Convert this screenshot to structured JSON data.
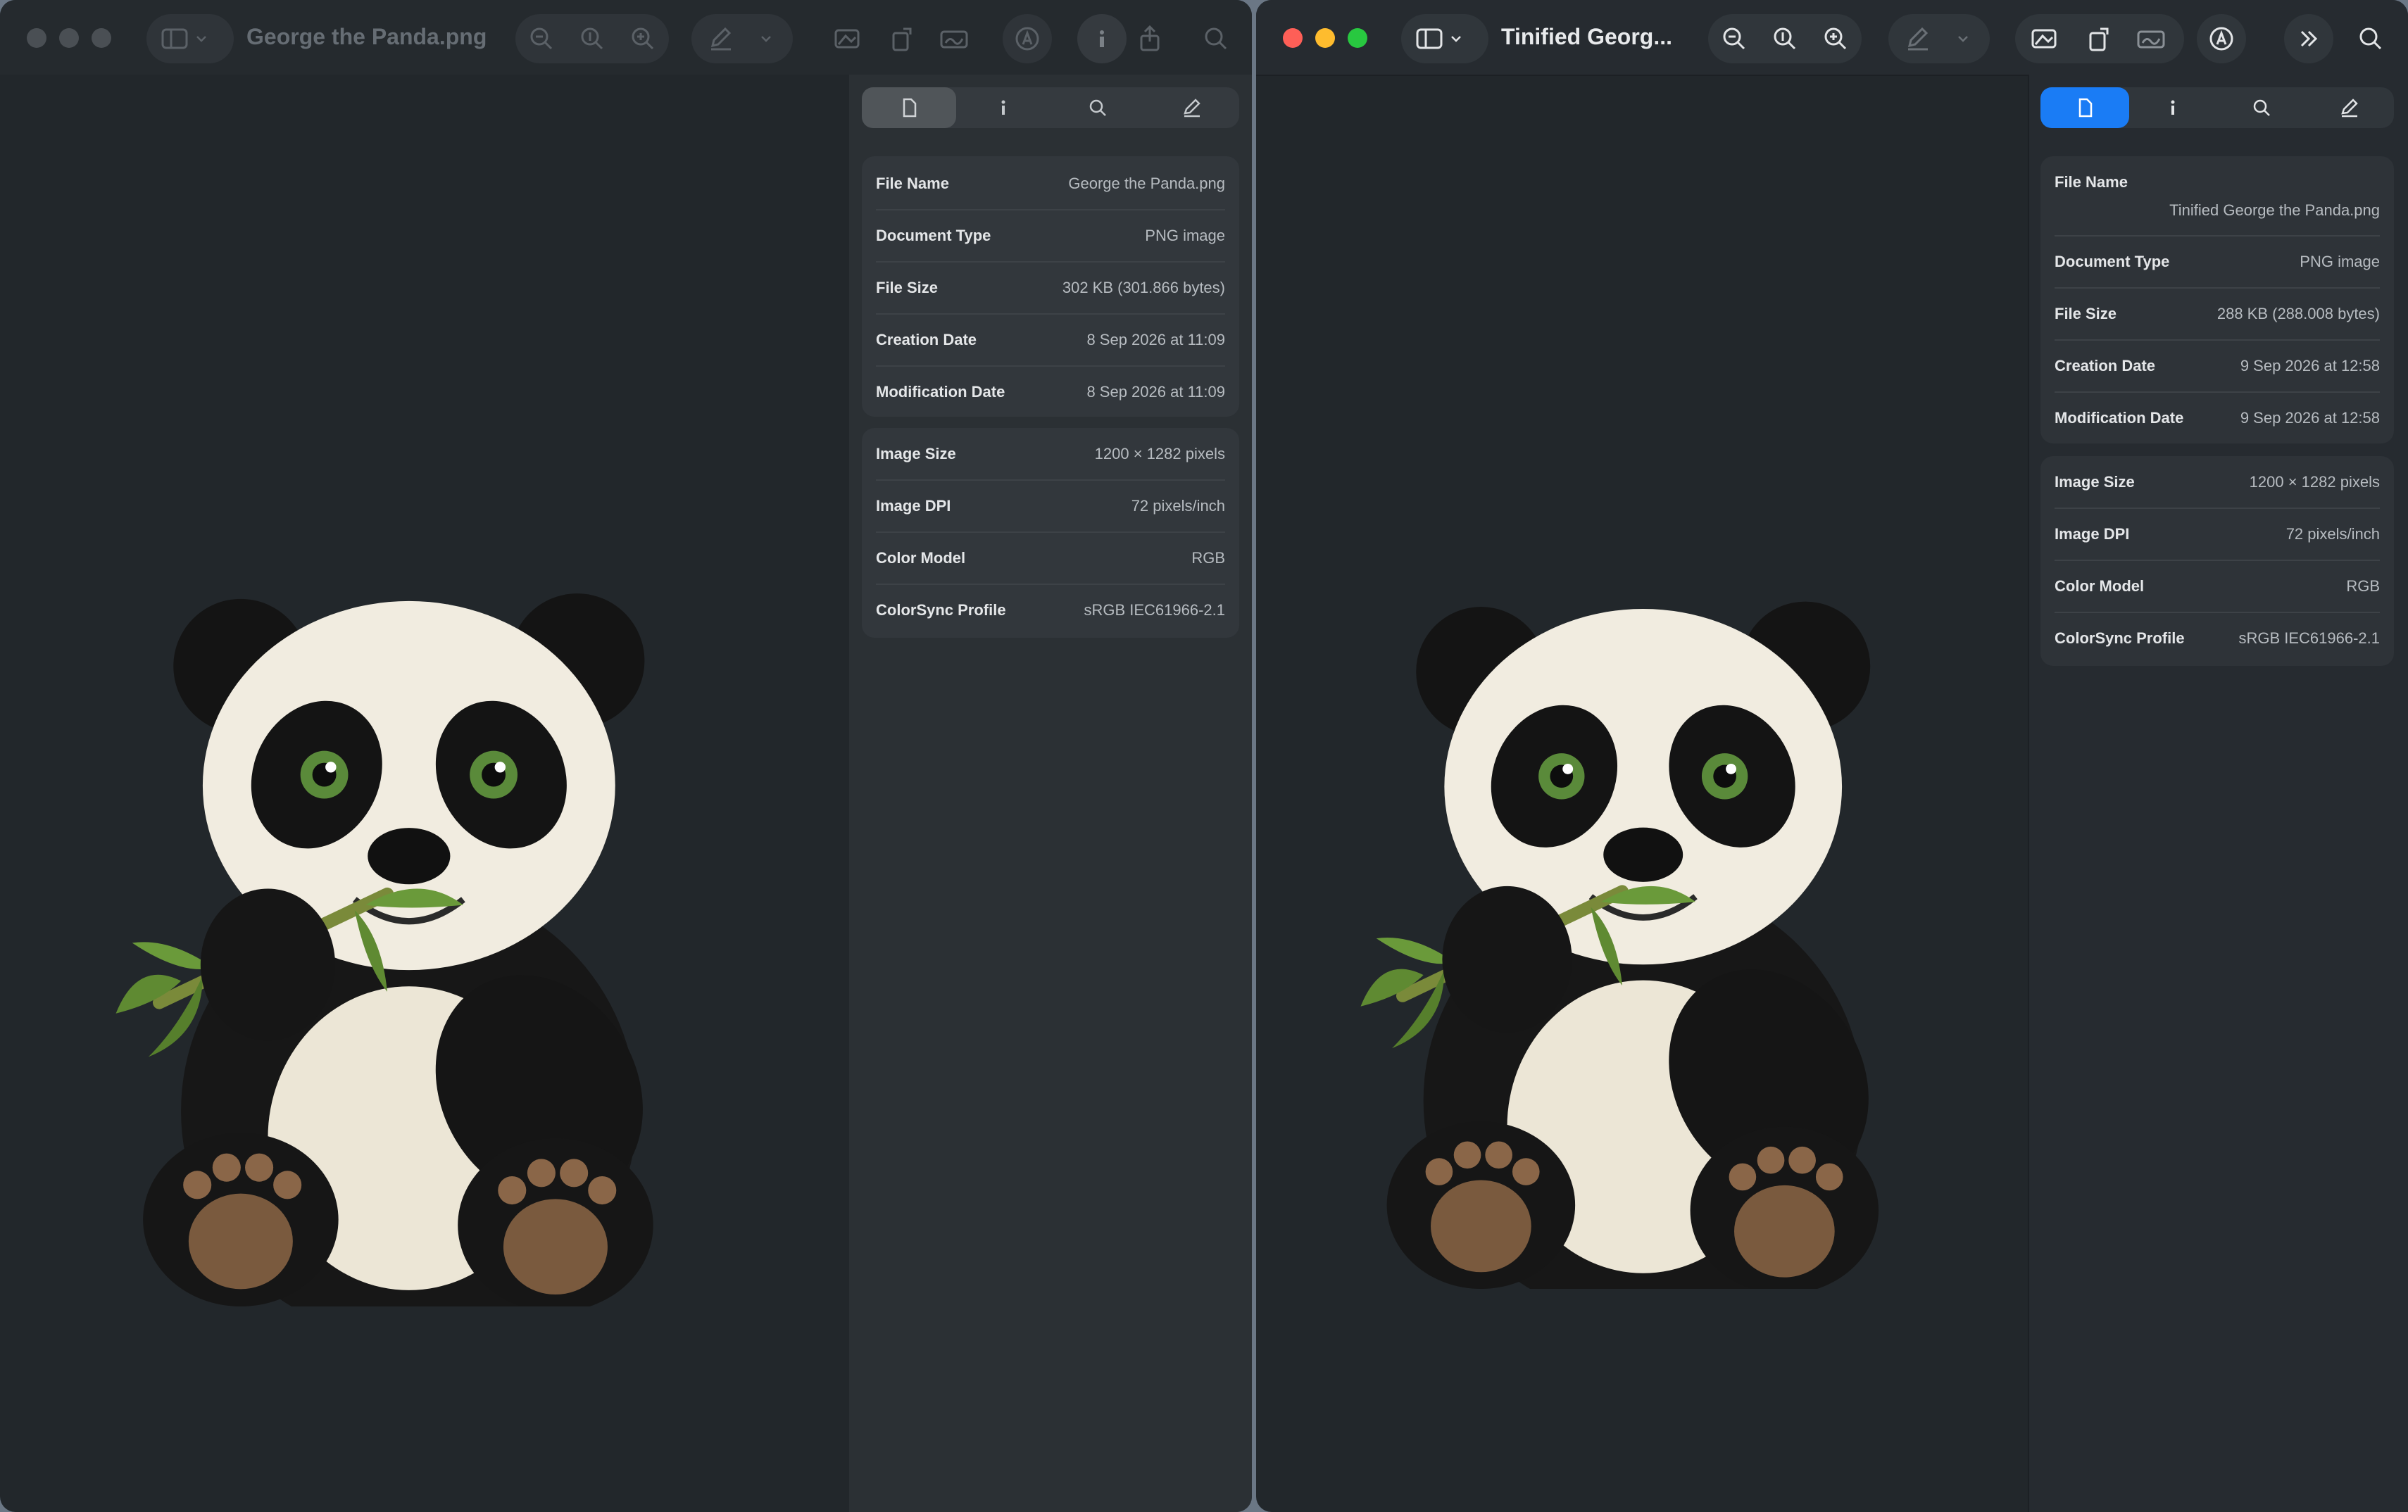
{
  "left_window": {
    "title": "George the Panda.png",
    "info": {
      "file": [
        {
          "label": "File Name",
          "value": "George the Panda.png"
        },
        {
          "label": "Document Type",
          "value": "PNG image"
        },
        {
          "label": "File Size",
          "value": "302 KB (301.866 bytes)"
        },
        {
          "label": "Creation Date",
          "value": "8 Sep 2026 at 11:09"
        },
        {
          "label": "Modification Date",
          "value": "8 Sep 2026 at 11:09"
        }
      ],
      "image": [
        {
          "label": "Image Size",
          "value": "1200 × 1282 pixels"
        },
        {
          "label": "Image DPI",
          "value": "72 pixels/inch"
        },
        {
          "label": "Color Model",
          "value": "RGB"
        },
        {
          "label": "ColorSync Profile",
          "value": "sRGB IEC61966-2.1"
        }
      ]
    }
  },
  "right_window": {
    "title": "Tinified Georg...",
    "info": {
      "file": [
        {
          "label": "File Name",
          "value": "Tinified George the Panda.png"
        },
        {
          "label": "Document Type",
          "value": "PNG image"
        },
        {
          "label": "File Size",
          "value": "288 KB (288.008 bytes)"
        },
        {
          "label": "Creation Date",
          "value": "9 Sep 2026 at 12:58"
        },
        {
          "label": "Modification Date",
          "value": "9 Sep 2026 at 12:58"
        }
      ],
      "image": [
        {
          "label": "Image Size",
          "value": "1200 × 1282 pixels"
        },
        {
          "label": "Image DPI",
          "value": "72 pixels/inch"
        },
        {
          "label": "Color Model",
          "value": "RGB"
        },
        {
          "label": "ColorSync Profile",
          "value": "sRGB IEC61966-2.1"
        }
      ]
    }
  },
  "colors": {
    "accent": "#1a7cf5",
    "close": "#fe5f57",
    "minimize": "#febc2e",
    "zoom": "#28c840",
    "inactive_light": "#4a4f54"
  }
}
